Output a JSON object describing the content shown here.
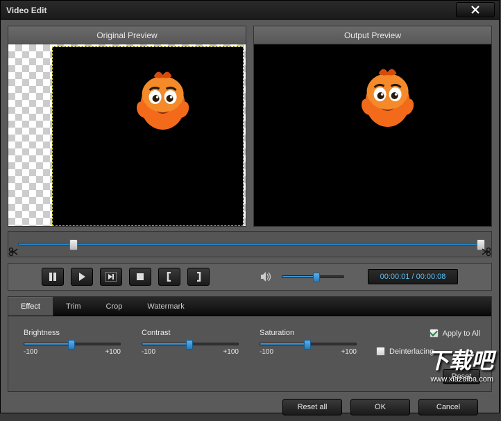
{
  "window": {
    "title": "Video Edit"
  },
  "preview": {
    "original_label": "Original Preview",
    "output_label": "Output Preview"
  },
  "timeline": {
    "position_pct": 11,
    "end_pct": 100
  },
  "controls": {
    "volume_pct": 54,
    "time_display": "00:00:01 / 00:00:08"
  },
  "tabs": {
    "items": [
      {
        "label": "Effect",
        "active": true
      },
      {
        "label": "Trim",
        "active": false
      },
      {
        "label": "Crop",
        "active": false
      },
      {
        "label": "Watermark",
        "active": false
      }
    ]
  },
  "effects": {
    "sliders": [
      {
        "name": "Brightness",
        "min": "-100",
        "max": "+100",
        "value_pct": 50
      },
      {
        "name": "Contrast",
        "min": "-100",
        "max": "+100",
        "value_pct": 50
      },
      {
        "name": "Saturation",
        "min": "-100",
        "max": "+100",
        "value_pct": 50
      }
    ],
    "deinterlacing": {
      "label": "Deinterlacing",
      "checked": false
    },
    "apply_all": {
      "label": "Apply to All",
      "checked": true
    },
    "reset_label": "Reset"
  },
  "buttons": {
    "reset_all": "Reset all",
    "ok": "OK",
    "cancel": "Cancel"
  },
  "overlay": {
    "cn": "下载吧",
    "en": "www.xiazaiba.com"
  }
}
